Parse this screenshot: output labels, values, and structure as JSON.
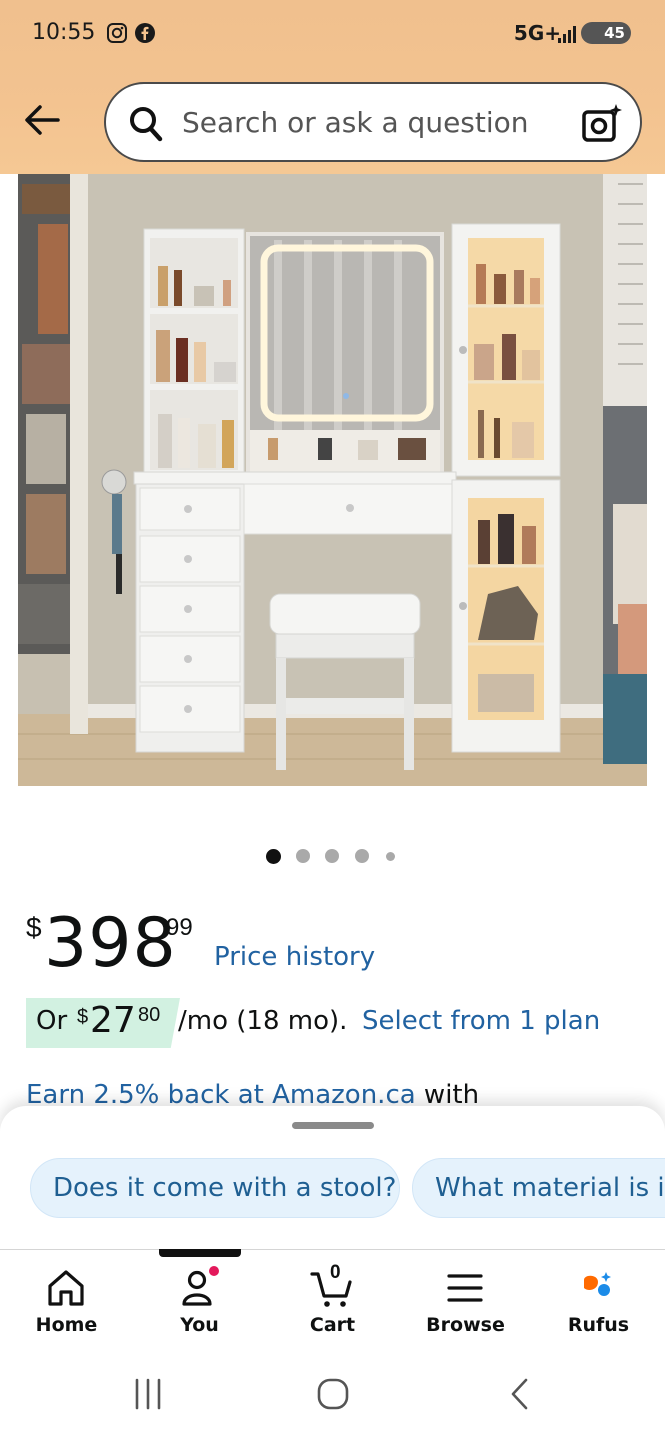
{
  "status_bar": {
    "time": "10:55",
    "network": "5G+",
    "battery": "45",
    "icons": [
      "instagram-icon",
      "facebook-icon",
      "signal-icon",
      "battery-icon"
    ]
  },
  "header": {
    "back_icon": "arrow-left-icon",
    "search_placeholder": "Search or ask a question",
    "camera_icon": "camera-lens-icon"
  },
  "product": {
    "image_alt": "White vanity desk with lighted mirror, drawers, glass cabinets and stool",
    "carousel": {
      "count": 5,
      "active": 0
    },
    "price": {
      "currency": "$",
      "whole": "398",
      "fraction": "99"
    },
    "price_history_label": "Price history",
    "installment": {
      "or": "Or",
      "currency": "$",
      "whole": "27",
      "fraction": "80",
      "term": "/mo (18 mo).",
      "select_label": "Select from 1 plan"
    },
    "earn": {
      "link": "Earn 2.5% back at Amazon.ca",
      "suffix": " with"
    }
  },
  "rufus_sheet": {
    "chips": [
      "Does it come with a stool?",
      "What material is it"
    ]
  },
  "tabbar": {
    "items": [
      {
        "label": "Home",
        "icon": "home-icon"
      },
      {
        "label": "You",
        "icon": "person-icon"
      },
      {
        "label": "Cart",
        "icon": "cart-icon",
        "badge": "0"
      },
      {
        "label": "Browse",
        "icon": "menu-icon"
      },
      {
        "label": "Rufus",
        "icon": "rufus-icon"
      }
    ],
    "active_index": 1
  },
  "system_nav": {
    "buttons": [
      "recents-icon",
      "home-circle-icon",
      "back-chevron-icon"
    ]
  },
  "colors": {
    "link": "#2162a1",
    "header": "#f3c390",
    "chip_bg": "#e5f2fc",
    "plan_badge": "#d2f1e1"
  }
}
